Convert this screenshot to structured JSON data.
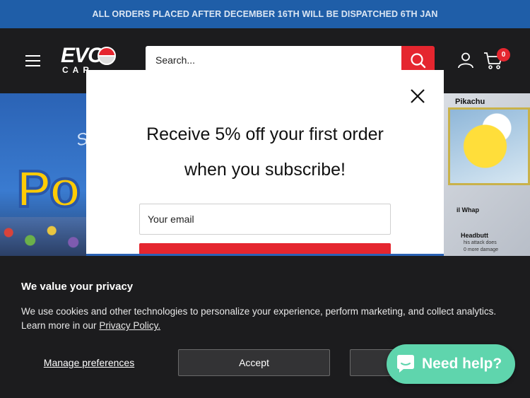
{
  "announcement": "ALL ORDERS PLACED AFTER DECEMBER 16TH WILL BE DISPATCHED 6TH JAN",
  "header": {
    "logo_text": "EVO",
    "logo_sub": "CAR",
    "search_placeholder": "Search...",
    "cart_count": "0"
  },
  "hero": {
    "since_text": "Sin",
    "poke_text": "Po",
    "card_name": "Pikachu",
    "card_attack1": "il Whap",
    "card_attack2": "Headbutt",
    "card_attack3": "his attack does",
    "card_attack4": "0 more damage"
  },
  "popup": {
    "title_line1": "Receive 5% off your first order",
    "title_line2": "when you subscribe!",
    "email_placeholder": "Your email"
  },
  "cookie": {
    "title": "We value your privacy",
    "body": "We use cookies and other technologies to personalize your experience, perform marketing, and collect analytics. Learn more in our ",
    "policy_link": "Privacy Policy.",
    "manage_label": "Manage preferences",
    "accept_label": "Accept",
    "decline_label": ""
  },
  "chat": {
    "label": "Need help?"
  },
  "colors": {
    "announcement_bg": "#1f5ea8",
    "brand_red": "#e5262f",
    "chat_green": "#5fd5ad",
    "dark_bg": "#1c1c1e"
  }
}
